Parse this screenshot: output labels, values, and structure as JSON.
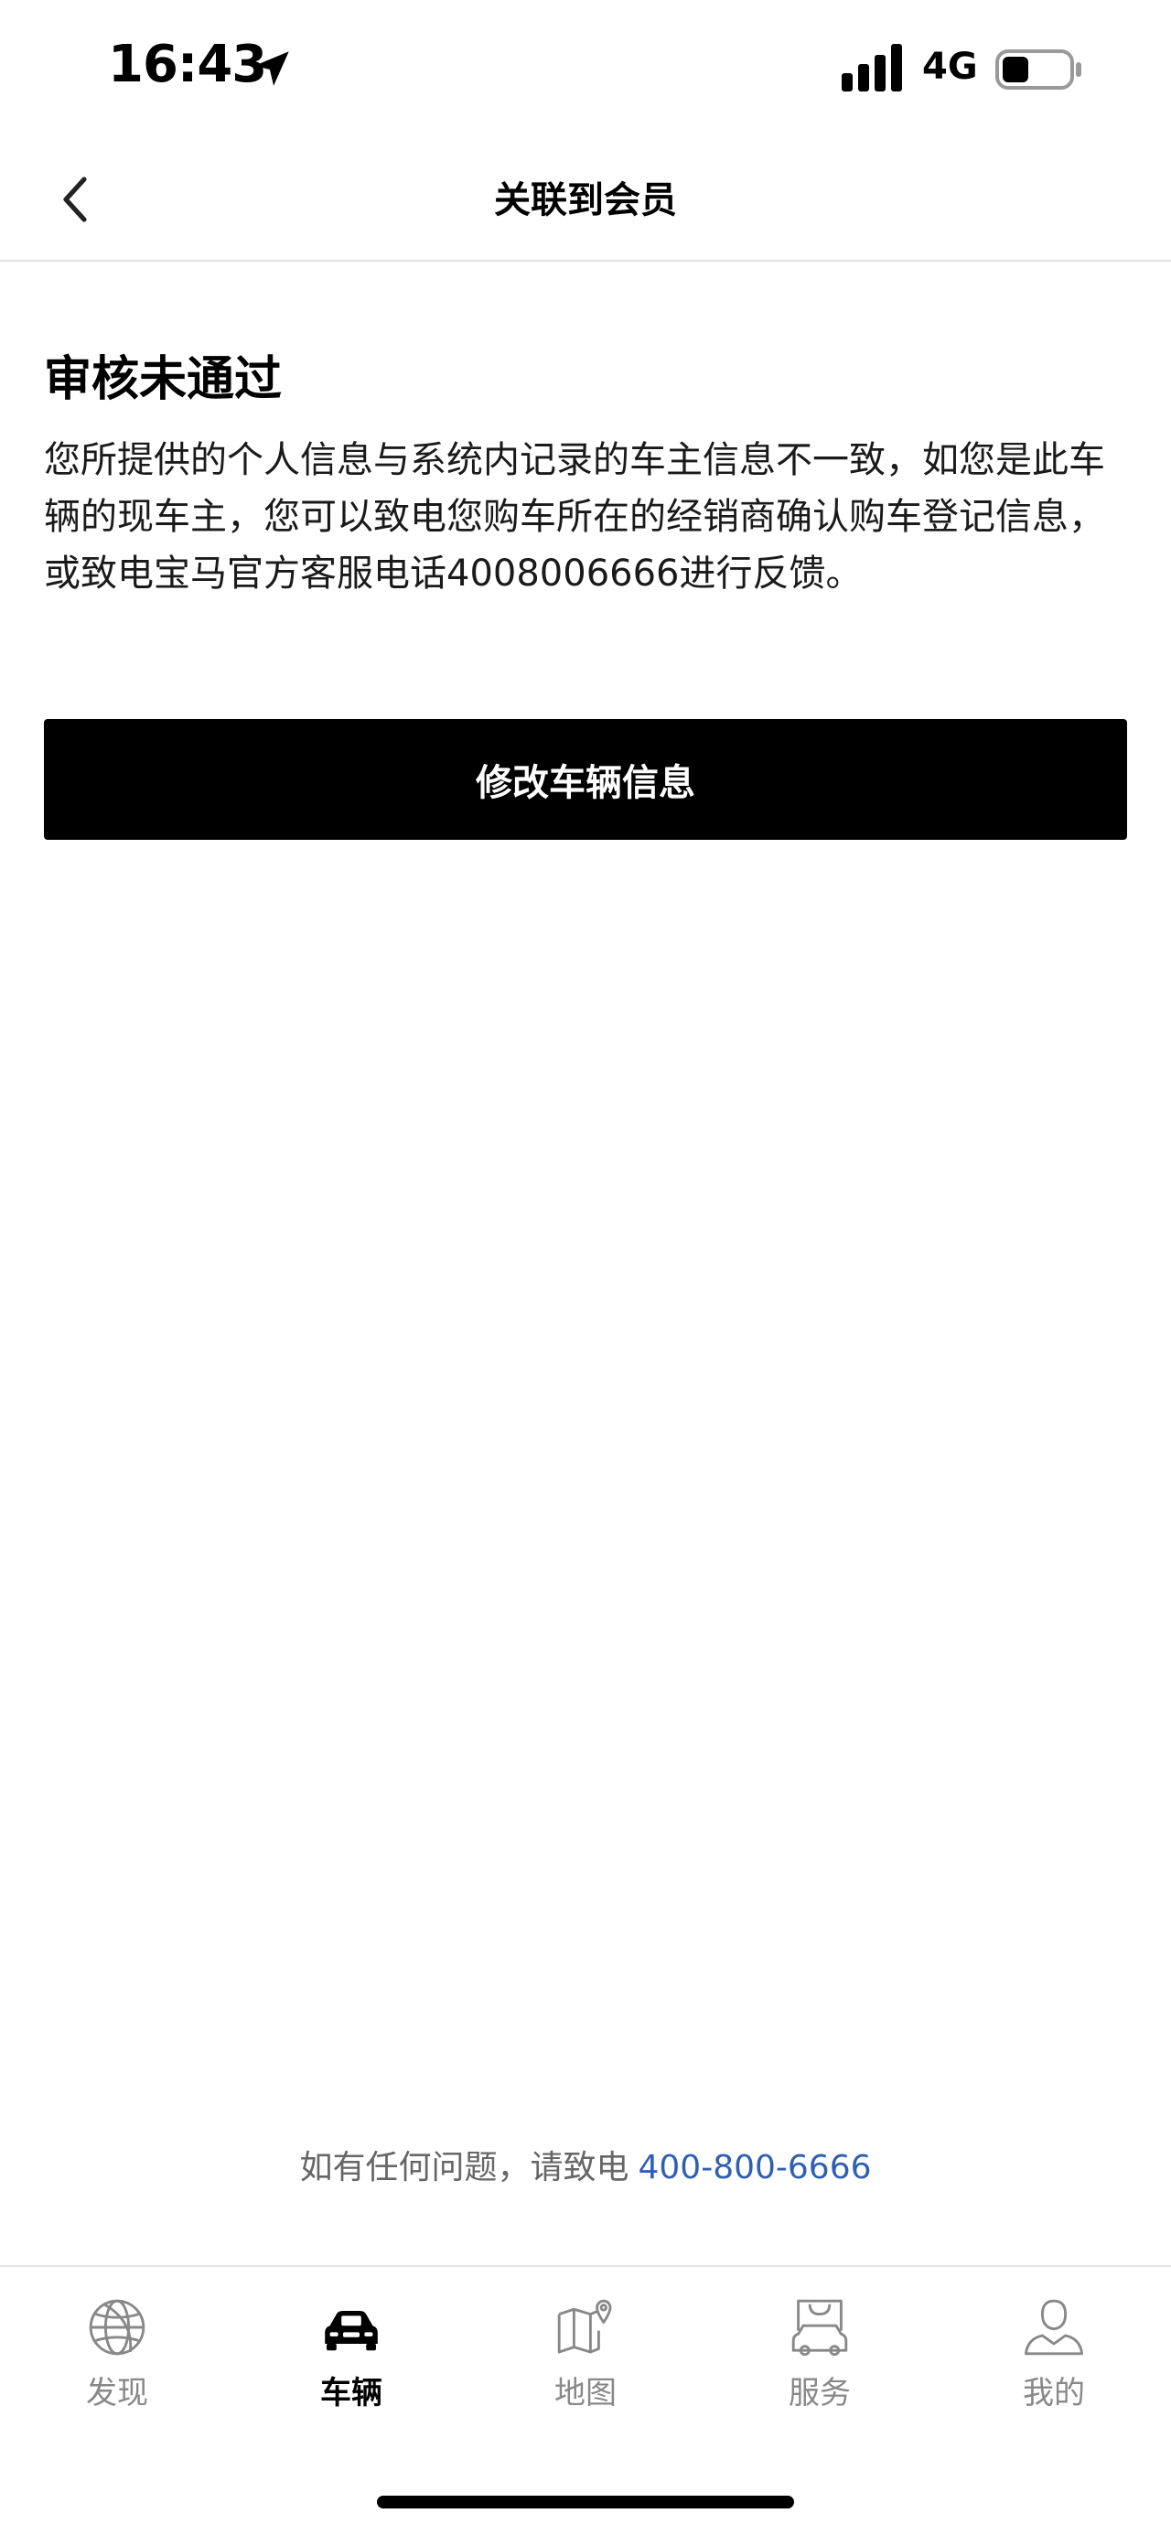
{
  "status_bar": {
    "time": "16:43",
    "network": "4G",
    "icons": [
      "location-arrow-icon",
      "signal-icon",
      "battery-icon"
    ]
  },
  "nav": {
    "title": "关联到会员",
    "back_icon": "chevron-left-icon"
  },
  "content": {
    "title": "审核未通过",
    "message": "您所提供的个人信息与系统内记录的车主信息不一致，如您是此车辆的现车主，您可以致电您购车所在的经销商确认购车登记信息，或致电宝马官方客服电话4008006666进行反馈。",
    "button_label": "修改车辆信息"
  },
  "contact": {
    "prefix": "如有任何问题，请致电",
    "phone": "400-800-6666"
  },
  "tabs": [
    {
      "label": "发现",
      "icon": "globe-icon",
      "active": false
    },
    {
      "label": "车辆",
      "icon": "car-icon",
      "active": true
    },
    {
      "label": "地图",
      "icon": "map-icon",
      "active": false
    },
    {
      "label": "服务",
      "icon": "shopping-bag-car-icon",
      "active": false
    },
    {
      "label": "我的",
      "icon": "user-icon",
      "active": false
    }
  ],
  "colors": {
    "button_bg": "#000000",
    "link": "#2f5fb3",
    "tab_inactive": "#888888"
  }
}
